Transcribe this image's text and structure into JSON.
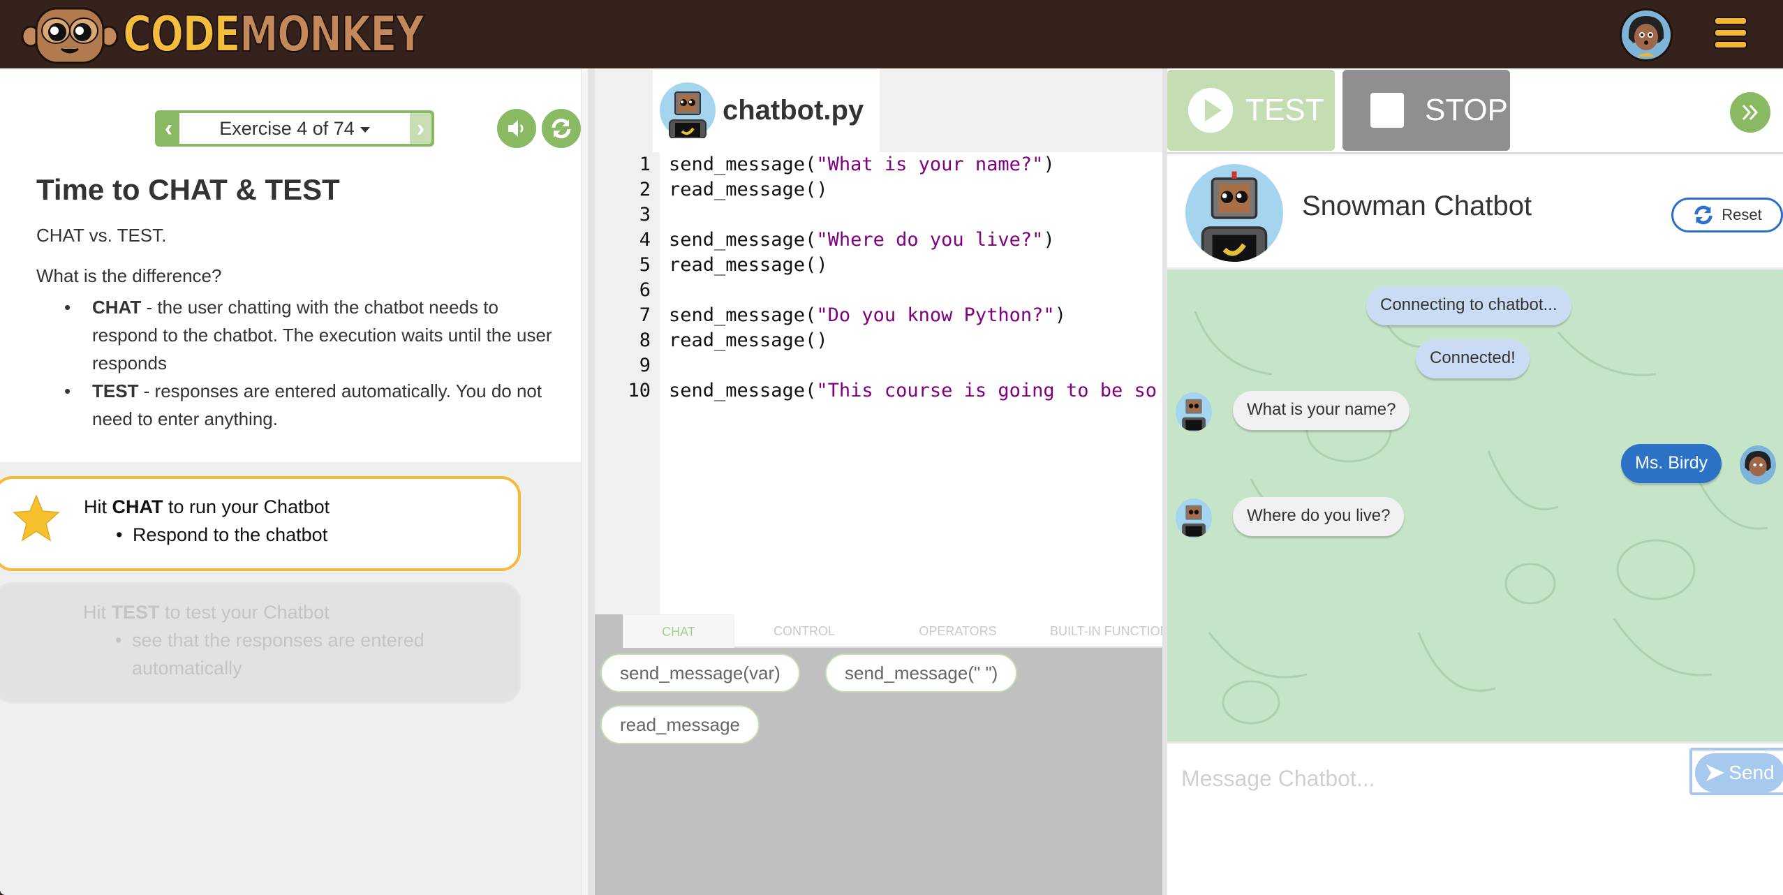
{
  "header": {
    "logo_part1": "CODE",
    "logo_part2": "MONKEY",
    "avatar_icon": "user-avatar",
    "menu_icon": "hamburger-menu-icon"
  },
  "lesson": {
    "exercise_label": "Exercise 4 of 74",
    "prev_icon": "chevron-left",
    "next_icon": "chevron-right",
    "sound_icon": "speaker-icon",
    "restart_icon": "refresh-icon",
    "title": "Time to CHAT & TEST",
    "subtitle": "CHAT vs. TEST.",
    "question": "What is the difference?",
    "points": [
      {
        "bold": "CHAT",
        "text": " - the user chatting with the chatbot needs to respond to the chatbot. The execution waits until the user responds"
      },
      {
        "bold": "TEST",
        "text": " - responses are entered automatically. You do not need to enter anything."
      }
    ],
    "tasks": [
      {
        "prefix": "Hit ",
        "bold": "CHAT",
        "suffix": " to run your Chatbot",
        "sub": "Respond to the chatbot",
        "state": "active"
      },
      {
        "prefix": "Hit ",
        "bold": "TEST",
        "suffix": " to test your Chatbot",
        "sub": "see that the responses are entered automatically",
        "state": "inactive"
      }
    ]
  },
  "editor": {
    "file_name": "chatbot.py",
    "lines": [
      {
        "n": "1",
        "fn": "send_message(",
        "str": "\"What is your name?\"",
        "end": ")"
      },
      {
        "n": "2",
        "fn": "read_message()",
        "str": "",
        "end": ""
      },
      {
        "n": "3",
        "fn": "",
        "str": "",
        "end": ""
      },
      {
        "n": "4",
        "fn": "send_message(",
        "str": "\"Where do you live?\"",
        "end": ")"
      },
      {
        "n": "5",
        "fn": "read_message()",
        "str": "",
        "end": ""
      },
      {
        "n": "6",
        "fn": "",
        "str": "",
        "end": ""
      },
      {
        "n": "7",
        "fn": "send_message(",
        "str": "\"Do you know Python?\"",
        "end": ")"
      },
      {
        "n": "8",
        "fn": "read_message()",
        "str": "",
        "end": ""
      },
      {
        "n": "9",
        "fn": "",
        "str": "",
        "end": ""
      },
      {
        "n": "10",
        "fn": "send_message(",
        "str": "\"This course is going to be so",
        "end": ""
      }
    ],
    "toolbox_tabs": [
      "CHAT",
      "CONTROL",
      "OPERATORS",
      "BUILT-IN FUNCTIONS"
    ],
    "active_tab": "CHAT",
    "blocks": [
      "send_message(var)",
      "send_message(\" \")",
      "read_message"
    ]
  },
  "runner": {
    "test_label": "TEST",
    "stop_label": "STOP",
    "collapse_icon": "double-chevron-right",
    "bot_name": "Snowman Chatbot",
    "reset_label": "Reset",
    "messages": [
      {
        "type": "system",
        "text": "Connecting to chatbot..."
      },
      {
        "type": "system",
        "text": "Connected!"
      },
      {
        "type": "bot",
        "text": "What is your name?"
      },
      {
        "type": "user",
        "text": "Ms. Birdy"
      },
      {
        "type": "bot",
        "text": "Where do you live?"
      }
    ],
    "input_placeholder": "Message Chatbot...",
    "input_value": "",
    "send_label": "Send"
  },
  "colors": {
    "header_bg": "#36221d",
    "accent_green": "#8ab963",
    "task_border": "#f6b93b",
    "code_string": "#800080",
    "user_bubble": "#2c72c6",
    "system_bubble": "#cadcf3",
    "chat_bg": "#c6e4c8"
  }
}
